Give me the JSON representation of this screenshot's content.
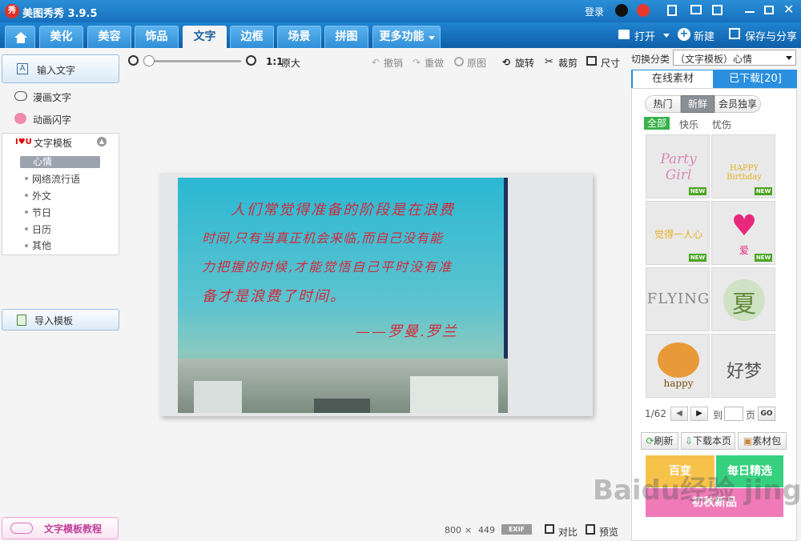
{
  "app": {
    "title": "美图秀秀 3.9.5",
    "logo_text": "秀",
    "login": "登录"
  },
  "tabs": [
    {
      "label": "美化"
    },
    {
      "label": "美容"
    },
    {
      "label": "饰品"
    },
    {
      "label": "文字"
    },
    {
      "label": "边框"
    },
    {
      "label": "场景"
    },
    {
      "label": "拼图"
    },
    {
      "label": "更多功能"
    }
  ],
  "actions": {
    "open": "打开",
    "new": "新建",
    "save": "保存与分享"
  },
  "left": {
    "input_text": "输入文字",
    "comic_text": "漫画文字",
    "anim_text": "动画闪字",
    "template": "文字模板",
    "sub_items": [
      "心情",
      "网络流行语",
      "外文",
      "节日",
      "日历",
      "其他"
    ],
    "import": "导入模板",
    "tutorial": "文字模板教程"
  },
  "toolbar": {
    "original_size": "1:1",
    "original_size_label": "原大",
    "undo": "撤销",
    "redo": "重做",
    "original": "原图",
    "rotate": "旋转",
    "crop": "裁剪",
    "size": "尺寸"
  },
  "photo": {
    "lines": [
      "人们常觉得准备的阶段是在浪费",
      "时间,只有当真正机会来临,而自己没有能",
      "力把握的时候,才能觉悟自己平时没有准",
      "备才是浪费了时间。"
    ],
    "signature": "——罗曼.罗兰"
  },
  "right": {
    "switch_label": "切换分类",
    "category": "（文字模板）心情",
    "tab_online": "在线素材",
    "tab_downloaded": "已下载[20]",
    "pills": [
      "热门",
      "新鲜",
      "会员独享"
    ],
    "filters": [
      "全部",
      "快乐",
      "忧伤"
    ],
    "thumbs": [
      {
        "text": "Party Girl",
        "color": "#d98ab4",
        "new": "NEW"
      },
      {
        "text": "HAPPY Birthday",
        "color": "#e0b020",
        "new": "NEW"
      },
      {
        "text": "觉得一人心",
        "color": "#e6b020",
        "new": "NEW"
      },
      {
        "text": "爱",
        "color": "#e8287a",
        "new": "NEW"
      },
      {
        "text": "FLYING",
        "color": "#888",
        "new": ""
      },
      {
        "text": "夏",
        "color": "#7a9a50",
        "new": ""
      },
      {
        "text": "happy",
        "color": "#c87a20",
        "new": ""
      },
      {
        "text": "好梦",
        "color": "#666",
        "new": ""
      }
    ],
    "page": "1/62",
    "goto": "到",
    "page_unit": "页",
    "go": "GO",
    "refresh": "刷新",
    "download_page": "下载本页",
    "pack": "素材包",
    "banners": [
      "百变",
      "每日精选",
      "初秋新品"
    ]
  },
  "status": {
    "w": "800",
    "x": "×",
    "h": "449",
    "exif": "EXIF",
    "compare": "对比",
    "preview": "预览"
  },
  "watermark": "Baidu经验 jingyan.baidu.com"
}
